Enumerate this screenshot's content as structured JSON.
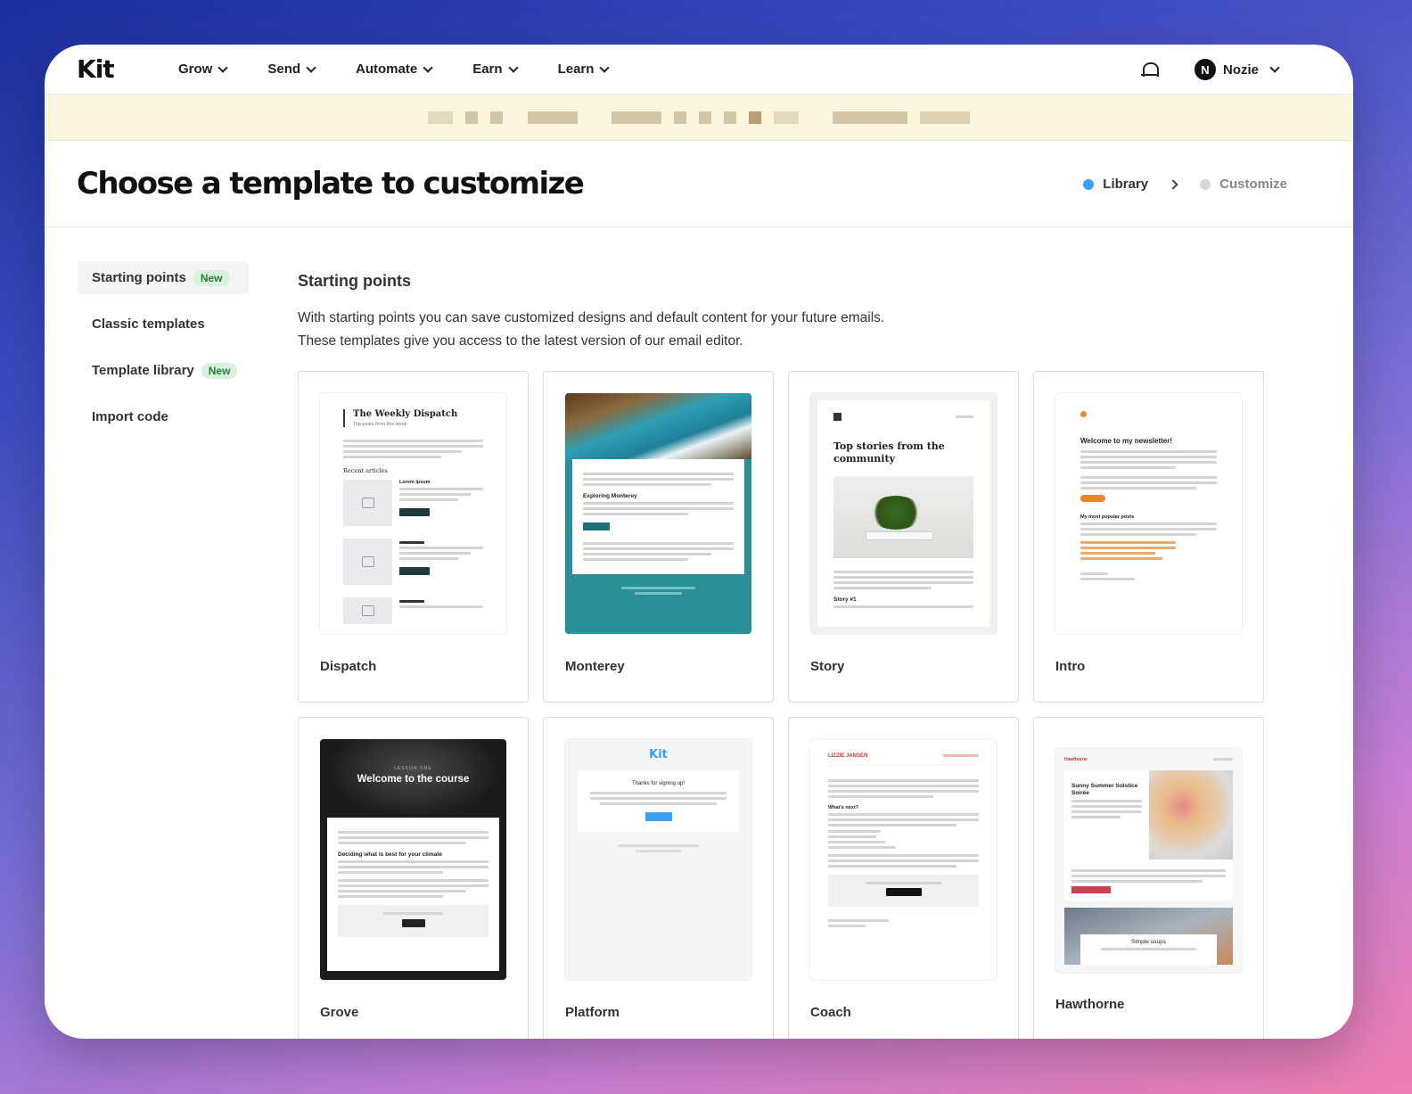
{
  "nav": {
    "logo": "Kit",
    "items": [
      {
        "label": "Grow"
      },
      {
        "label": "Send"
      },
      {
        "label": "Automate"
      },
      {
        "label": "Earn"
      },
      {
        "label": "Learn"
      }
    ],
    "user": {
      "initial": "N",
      "name": "Nozie"
    }
  },
  "header": {
    "title": "Choose a template to customize",
    "steps": [
      {
        "label": "Library",
        "color": "#3aa0f0",
        "active": true
      },
      {
        "label": "Customize",
        "color": "#d8d8d8",
        "active": false
      }
    ]
  },
  "sidebar": {
    "items": [
      {
        "label": "Starting points",
        "badge": "New",
        "active": true
      },
      {
        "label": "Classic templates",
        "badge": "",
        "active": false
      },
      {
        "label": "Template library",
        "badge": "New",
        "active": false
      },
      {
        "label": "Import code",
        "badge": "",
        "active": false
      }
    ]
  },
  "main": {
    "title": "Starting points",
    "description_line1": "With starting points you can save customized designs and default content for your future emails.",
    "description_line2": "These templates give you access to the latest version of our email editor.",
    "templates": [
      {
        "name": "Dispatch"
      },
      {
        "name": "Monterey"
      },
      {
        "name": "Story"
      },
      {
        "name": "Intro"
      },
      {
        "name": "Grove"
      },
      {
        "name": "Platform"
      },
      {
        "name": "Coach"
      },
      {
        "name": "Hawthorne"
      }
    ]
  },
  "previews": {
    "dispatch": {
      "title": "The Weekly Dispatch",
      "subtitle": "Top posts from this week",
      "section": "Recent articles",
      "item": "Lorem ipsum"
    },
    "monterey": {
      "heading": "Exploring Monterey",
      "accent": "#2a8f96"
    },
    "story": {
      "title": "Top stories from the community",
      "item": "Story #1"
    },
    "intro": {
      "title": "Welcome to my newsletter!",
      "section": "My most popular posts",
      "accent": "#e8862f"
    },
    "grove": {
      "kicker": "LESSON ONE",
      "title": "Welcome to the course",
      "heading": "Deciding what is best for your climate"
    },
    "platform": {
      "logo": "Kit",
      "title": "Thanks for signing up!"
    },
    "coach": {
      "brand": "LIZZIE JANSEN",
      "section": "What's next?"
    },
    "hawthorne": {
      "brand": "Hawthorne",
      "title": "Sunny Summer Solstice Soirée",
      "section": "Simple soups"
    }
  },
  "colors": {
    "brand": "#111111",
    "banner": "#faf5de",
    "badge_bg": "#d8f3dc",
    "badge_fg": "#2c7a3f"
  }
}
